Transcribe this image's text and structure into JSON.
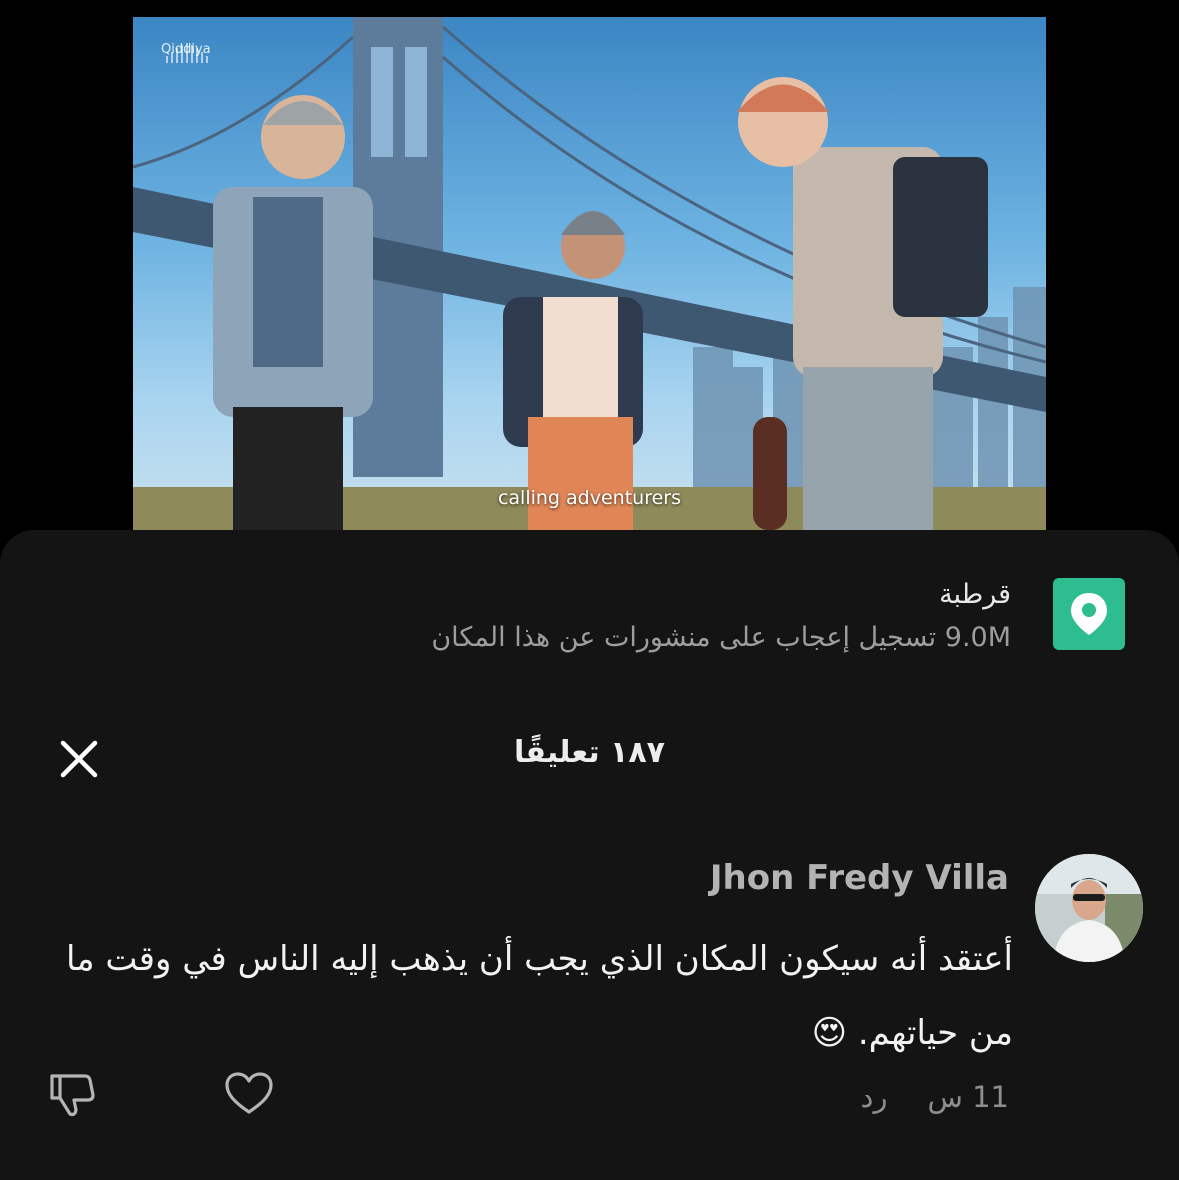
{
  "video": {
    "brand": "Qiddiya",
    "caption": "calling adventurers"
  },
  "place": {
    "name": "قرطبة",
    "likes_count": "9.0M",
    "likes_text": "تسجيل إعجاب على منشورات عن هذا المكان",
    "icon": "location-pin-icon",
    "icon_color": "#2ebd8f"
  },
  "comments_panel": {
    "title": "١٨٧ تعليقًا",
    "close_icon": "close-icon"
  },
  "comment": {
    "author": "Jhon Fredy Villa",
    "text": "أعتقد أنه سيكون المكان الذي يجب أن يذهب إليه الناس في وقت ما من حياتهم. 😍",
    "time": "11 س",
    "reply_label": "رد",
    "like_icon": "heart-icon",
    "dislike_icon": "thumbs-down-icon"
  },
  "colors": {
    "sheet_background": "#141414",
    "page_background": "#000000"
  }
}
